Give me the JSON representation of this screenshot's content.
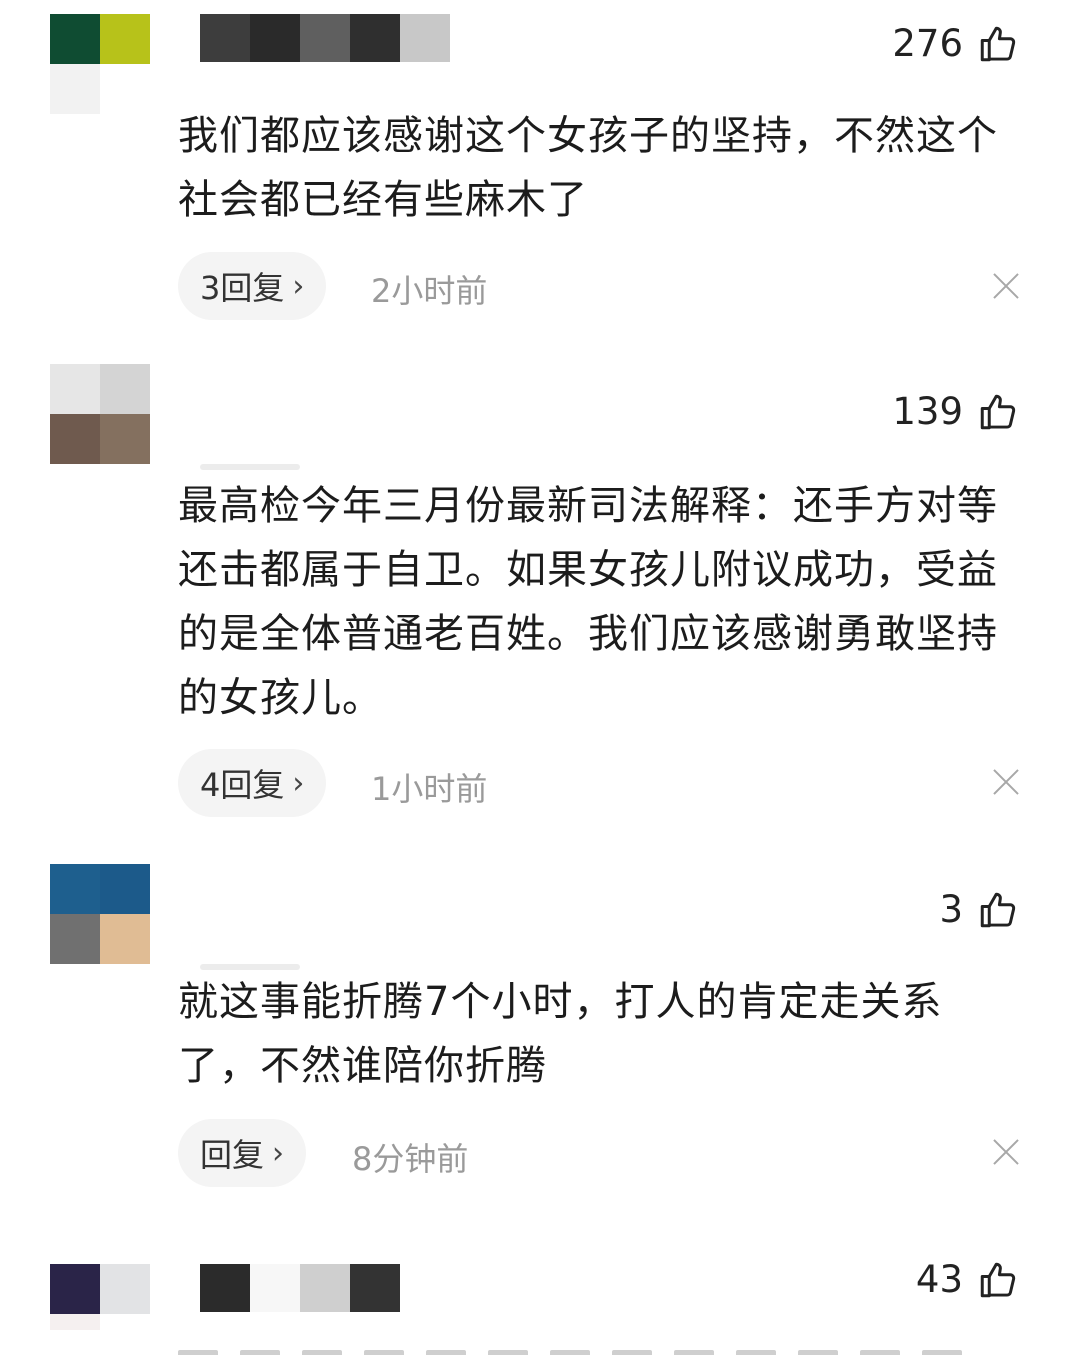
{
  "comments": [
    {
      "likes": "276",
      "text": "我们都应该感谢这个女孩子的坚持，不然这个社会都已经有些麻木了",
      "reply_label": "3回复",
      "time": "2小时前",
      "avatar_colors": [
        "#0f4c32",
        "#b7c21a",
        "#f2f2f2",
        "#ffffff"
      ]
    },
    {
      "likes": "139",
      "text": "最高检今年三月份最新司法解释：还手方对等还击都属于自卫。如果女孩儿附议成功，受益的是全体普通老百姓。我们应该感谢勇敢坚持的女孩儿。",
      "reply_label": "4回复",
      "time": "1小时前",
      "avatar_colors": [
        "#e6e6e6",
        "#d4d4d4",
        "#6f5a4e",
        "#84705f"
      ]
    },
    {
      "likes": "3",
      "text": "就这事能折腾7个小时，打人的肯定走关系了，不然谁陪你折腾",
      "reply_label": "回复",
      "time": "8分钟前",
      "avatar_colors": [
        "#1e5f8e",
        "#1c5a8a",
        "#707070",
        "#e0bc94"
      ]
    },
    {
      "likes": "43",
      "avatar_colors": [
        "#2a2448",
        "#e2e3e5",
        "#f5f0f0",
        "#ffffff"
      ]
    }
  ],
  "icons": {
    "like": "thumbs-up-icon",
    "reply_arrow": "chevron-right-icon",
    "dismiss": "close-icon"
  },
  "colors": {
    "text": "#1c1c1c",
    "secondary": "#9a9a9a",
    "pill_bg": "#f4f4f4"
  }
}
